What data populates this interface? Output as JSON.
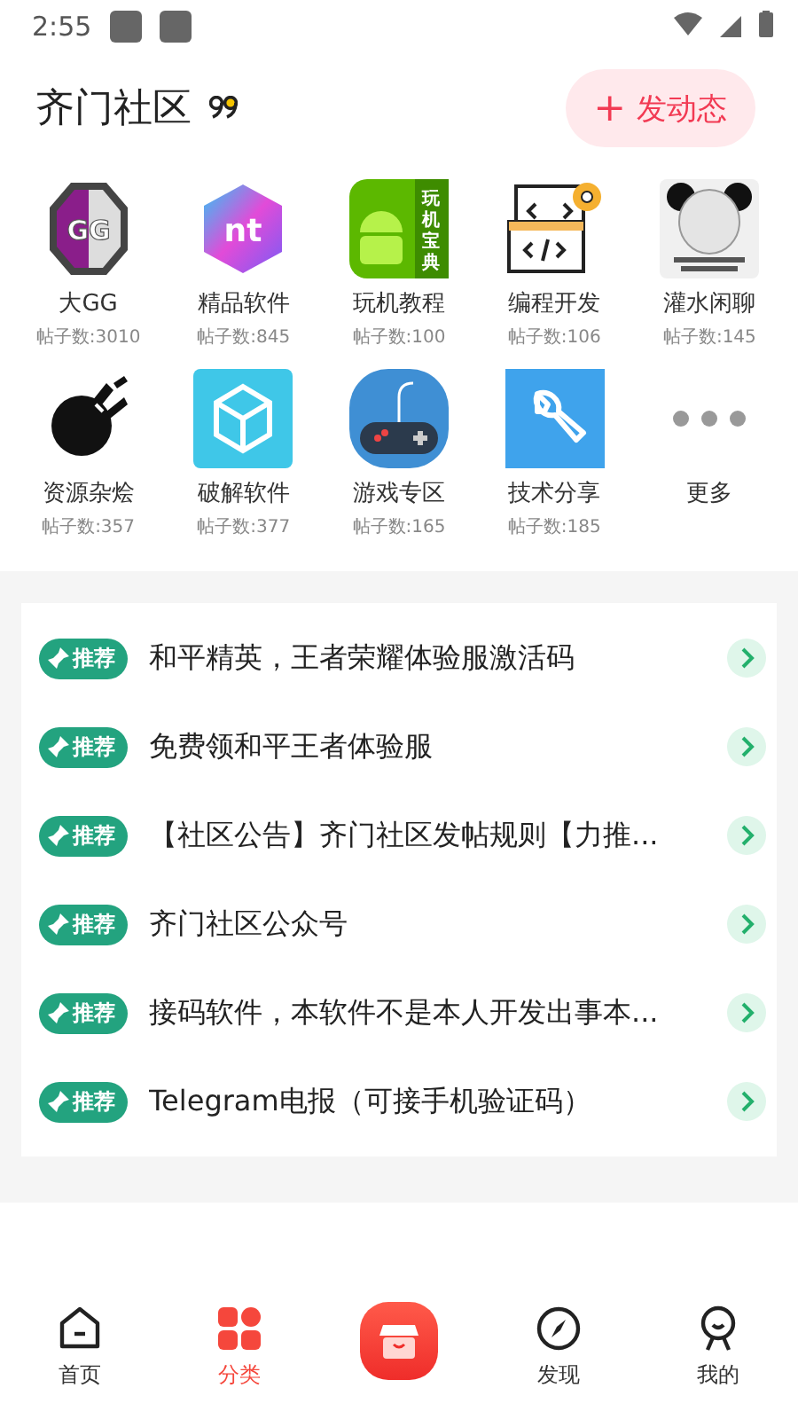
{
  "status_bar": {
    "time": "2:55"
  },
  "header": {
    "title": "齐门社区",
    "post_button": {
      "icon": "+",
      "label": "发动态"
    }
  },
  "categories": [
    {
      "name": "大GG",
      "count": "帖子数:3010",
      "icon_text": "GG"
    },
    {
      "name": "精品软件",
      "count": "帖子数:845",
      "icon_text": "nt"
    },
    {
      "name": "玩机教程",
      "count": "帖子数:100",
      "icon_text": "玩机宝典"
    },
    {
      "name": "编程开发",
      "count": "帖子数:106"
    },
    {
      "name": "灌水闲聊",
      "count": "帖子数:145"
    },
    {
      "name": "资源杂烩",
      "count": "帖子数:357"
    },
    {
      "name": "破解软件",
      "count": "帖子数:377"
    },
    {
      "name": "游戏专区",
      "count": "帖子数:165"
    },
    {
      "name": "技术分享",
      "count": "帖子数:185"
    },
    {
      "name": "更多"
    }
  ],
  "posts": [
    {
      "badge": "推荐",
      "title": "和平精英，王者荣耀体验服激活码"
    },
    {
      "badge": "推荐",
      "title": "免费领和平王者体验服"
    },
    {
      "badge": "推荐",
      "title": "【社区公告】齐门社区发帖规则【力推..."
    },
    {
      "badge": "推荐",
      "title": "齐门社区公众号"
    },
    {
      "badge": "推荐",
      "title": "接码软件，本软件不是本人开发出事本..."
    },
    {
      "badge": "推荐",
      "title": "Telegram电报（可接手机验证码）"
    }
  ],
  "bottom_nav": [
    {
      "kind": "tab",
      "label": "首页",
      "selected": false
    },
    {
      "kind": "tab",
      "label": "分类",
      "selected": true
    },
    {
      "kind": "center",
      "selected": false
    },
    {
      "kind": "tab",
      "label": "发现",
      "selected": false
    },
    {
      "kind": "tab",
      "label": "我的",
      "selected": false
    }
  ]
}
